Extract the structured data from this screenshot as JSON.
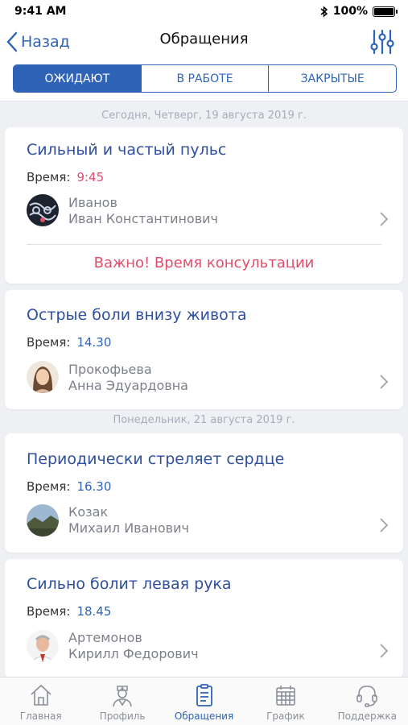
{
  "status_bar": {
    "time": "9:41 AM",
    "battery": "100%"
  },
  "nav": {
    "back_label": "Назад",
    "title": "Обращения"
  },
  "segments": [
    {
      "label": "ОЖИДАЮТ",
      "active": true
    },
    {
      "label": "В РАБОТЕ",
      "active": false
    },
    {
      "label": "ЗАКРЫТЫЕ",
      "active": false
    }
  ],
  "sections": [
    {
      "date": "Сегодня, Четверг, 19 августа 2019 г."
    },
    {
      "date": "Понедельник, 21 августа 2019 г."
    }
  ],
  "appointments": [
    {
      "title": "Сильный и частый пульс",
      "time_label": "Время:",
      "time": "9:45",
      "doctor_last": "Иванов",
      "doctor_first": "Иван Константинович",
      "alert": "Важно! Время консультации"
    },
    {
      "title": "Острые боли внизу живота",
      "time_label": "Время:",
      "time": "14.30",
      "doctor_last": "Прокофьева",
      "doctor_first": "Анна Эдуардовна"
    },
    {
      "title": "Периодически стреляет сердце",
      "time_label": "Время:",
      "time": "16.30",
      "doctor_last": "Козак",
      "doctor_first": "Михаил Иванович"
    },
    {
      "title": "Сильно болит левая рука",
      "time_label": "Время:",
      "time": "18.45",
      "doctor_last": "Артемонов",
      "doctor_first": "Кирилл Федорович"
    }
  ],
  "tabs": [
    {
      "label": "Главная",
      "icon": "home-icon"
    },
    {
      "label": "Профиль",
      "icon": "doctor-icon"
    },
    {
      "label": "Обращения",
      "icon": "clipboard-icon",
      "active": true
    },
    {
      "label": "График",
      "icon": "calendar-icon"
    },
    {
      "label": "Поддержка",
      "icon": "headset-icon"
    }
  ],
  "colors": {
    "accent": "#2f63b8",
    "title": "#2f4fa0",
    "urgent": "#e24d6a",
    "muted": "#7c8089"
  }
}
